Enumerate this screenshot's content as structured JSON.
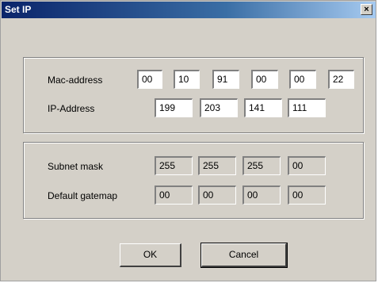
{
  "window": {
    "title": "Set IP",
    "close_glyph": "×"
  },
  "network": {
    "mac_label": "Mac-address",
    "mac": [
      "00",
      "10",
      "91",
      "00",
      "00",
      "22"
    ],
    "ip_label": "IP-Address",
    "ip": [
      "199",
      "203",
      "141",
      "111"
    ]
  },
  "subnet": {
    "mask_label": "Subnet mask",
    "mask": [
      "255",
      "255",
      "255",
      "00"
    ],
    "gateway_label": "Default gatemap",
    "gateway": [
      "00",
      "00",
      "00",
      "00"
    ]
  },
  "buttons": {
    "ok": "OK",
    "cancel": "Cancel"
  }
}
